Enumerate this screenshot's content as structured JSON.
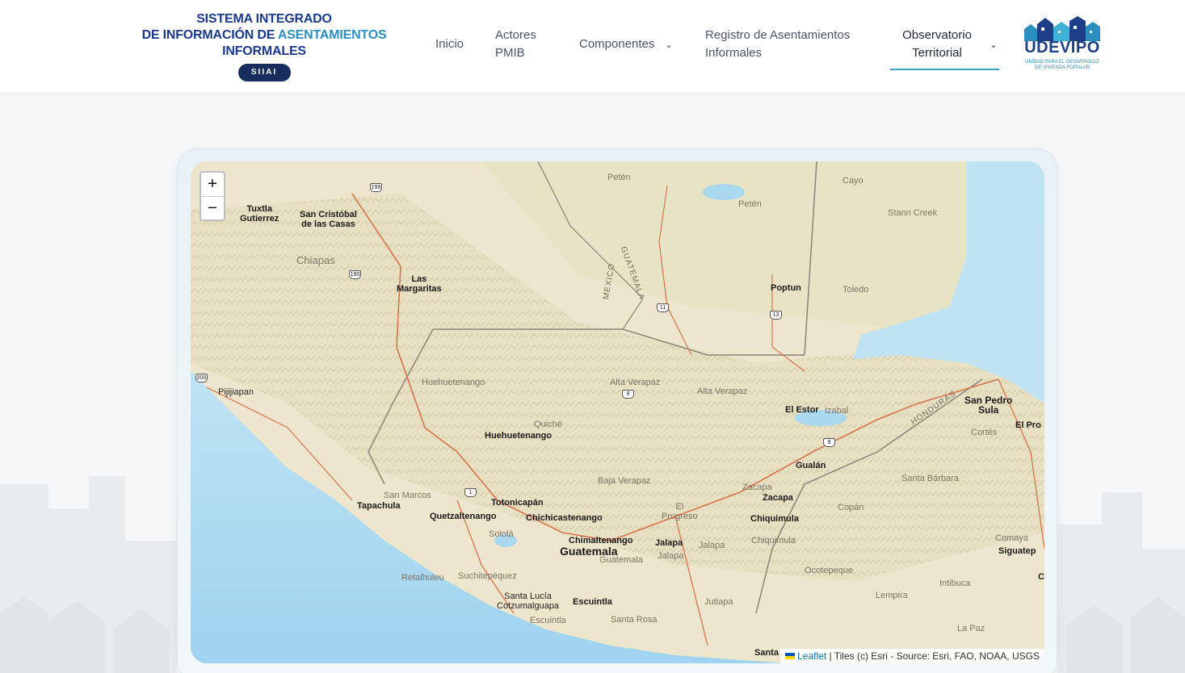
{
  "header": {
    "logo": {
      "line1": "SISTEMA INTEGRADO",
      "line2_a": "DE INFORMACIÓN DE ",
      "line2_b": "ASENTAMIENTOS",
      "line3": "INFORMALES",
      "badge": "SIIAI"
    },
    "nav": {
      "inicio": "Inicio",
      "actores_1": "Actores",
      "actores_2": "PMIB",
      "componentes": "Componentes",
      "registro_1": "Registro de Asentamientos",
      "registro_2": "Informales",
      "observatorio_1": "Observatorio",
      "observatorio_2": "Territorial"
    },
    "partner_logo": {
      "name": "UDEVIPO",
      "sub_1": "UNIDAD PARA EL DESARROLLO",
      "sub_2": "DE VIVIENDA POPULAR"
    }
  },
  "map": {
    "zoom_in": "+",
    "zoom_out": "−",
    "attribution": {
      "leaflet": "Leaflet",
      "tiles": " | Tiles (c) Esri - Source: Esri, FAO, NOAA, USGS"
    },
    "labels": {
      "tuxtla_1": "Tuxtla",
      "tuxtla_2": "Gutierrez",
      "sancris_1": "San Cristóbal",
      "sancris_2": "de las Casas",
      "chiapas": "Chiapas",
      "las_1": "Las",
      "las_2": "Margaritas",
      "peten_top": "Petén",
      "peten": "Petén",
      "cayo": "Cayo",
      "stann": "Stann Creek",
      "poptun": "Poptun",
      "toledo": "Toledo",
      "mexico": "MEXICO",
      "guatemala_border": "GUATEMALA",
      "honduras": "HONDURAS",
      "pijijiapan": "Pijijiapan",
      "huehue_region": "Huehuetenango",
      "alta_verapaz_1": "Alta Verapaz",
      "alta_verapaz_2": "Alta Verapaz",
      "el_estor": "El Estor",
      "izabal": "Izabal",
      "spsula_1": "San Pedro",
      "spsula_2": "Sula",
      "el_pro": "El Pro",
      "cortes": "Cortés",
      "quiche": "Quiché",
      "huehue_city": "Huehuetenango",
      "gualan": "Gualán",
      "baja_verapaz": "Baja Verapaz",
      "zacapa_region": "Zacapa",
      "zacapa_city": "Zacapa",
      "santa_barbara": "Santa Bárbara",
      "san_marcos": "San Marcos",
      "tapachula": "Tapachula",
      "totonicapan": "Totonicapán",
      "quetzaltenango": "Quetzaltenango",
      "chichicastenango": "Chichicastenango",
      "el_progreso_1": "El",
      "el_progreso_2": "Progreso",
      "chiquimula_city": "Chiquimula",
      "chiquimula_region": "Chiquimula",
      "copan": "Copán",
      "solola": "Sololá",
      "chimaltenango": "Chimaltenango",
      "guatemala_city": "Guatemala",
      "guatemala_region": "Guatemala",
      "jalapa_city": "Jalapa",
      "jalapa_region_1": "Jalapa",
      "jalapa_region_2": "Jalapa",
      "comayagua": "Comaya",
      "siguatepeque": "Siguatep",
      "retalhuleu": "Retalhuleu",
      "suchitepequez": "Suchitepéquez",
      "ocotepeque": "Ocotepeque",
      "intibuca": "Intibuca",
      "santa_lucia_1": "Santa Lucía",
      "santa_lucia_2": "Cotzumalguapa",
      "escuintla_city": "Escuintla",
      "jutiapa": "Jutiapa",
      "lempira": "Lempira",
      "escuintla_region": "Escuintla",
      "santa_rosa": "Santa Rosa",
      "la_paz": "La Paz",
      "santa_ana": "Santa",
      "c_edge": "C"
    },
    "shields": {
      "r199": "199",
      "r190": "190",
      "r200": "200",
      "r11": "11",
      "r13": "13",
      "r9a": "9",
      "r9b": "9",
      "r1": "1"
    }
  }
}
